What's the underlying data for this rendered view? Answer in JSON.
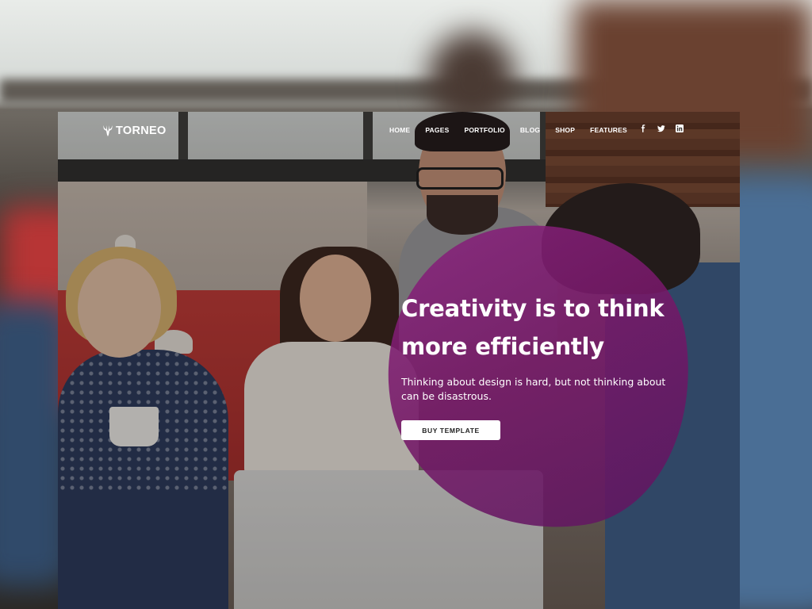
{
  "brand": {
    "name": "TORNEO",
    "color": "#ffffff"
  },
  "nav": {
    "items": [
      {
        "label": "HOME"
      },
      {
        "label": "PAGES"
      },
      {
        "label": "PORTFOLIO"
      },
      {
        "label": "BLOG"
      },
      {
        "label": "SHOP"
      },
      {
        "label": "FEATURES"
      }
    ],
    "social": [
      {
        "icon": "facebook-icon",
        "glyph": "f"
      },
      {
        "icon": "twitter-icon",
        "glyph": ""
      },
      {
        "icon": "linkedin-icon",
        "glyph": "in"
      }
    ]
  },
  "hero": {
    "headline": "Creativity is to think more efficiently",
    "subline": "Thinking about design is hard, but not thinking about can be disastrous.",
    "cta_label": "BUY TEMPLATE",
    "accent_color": "#8a227e"
  }
}
